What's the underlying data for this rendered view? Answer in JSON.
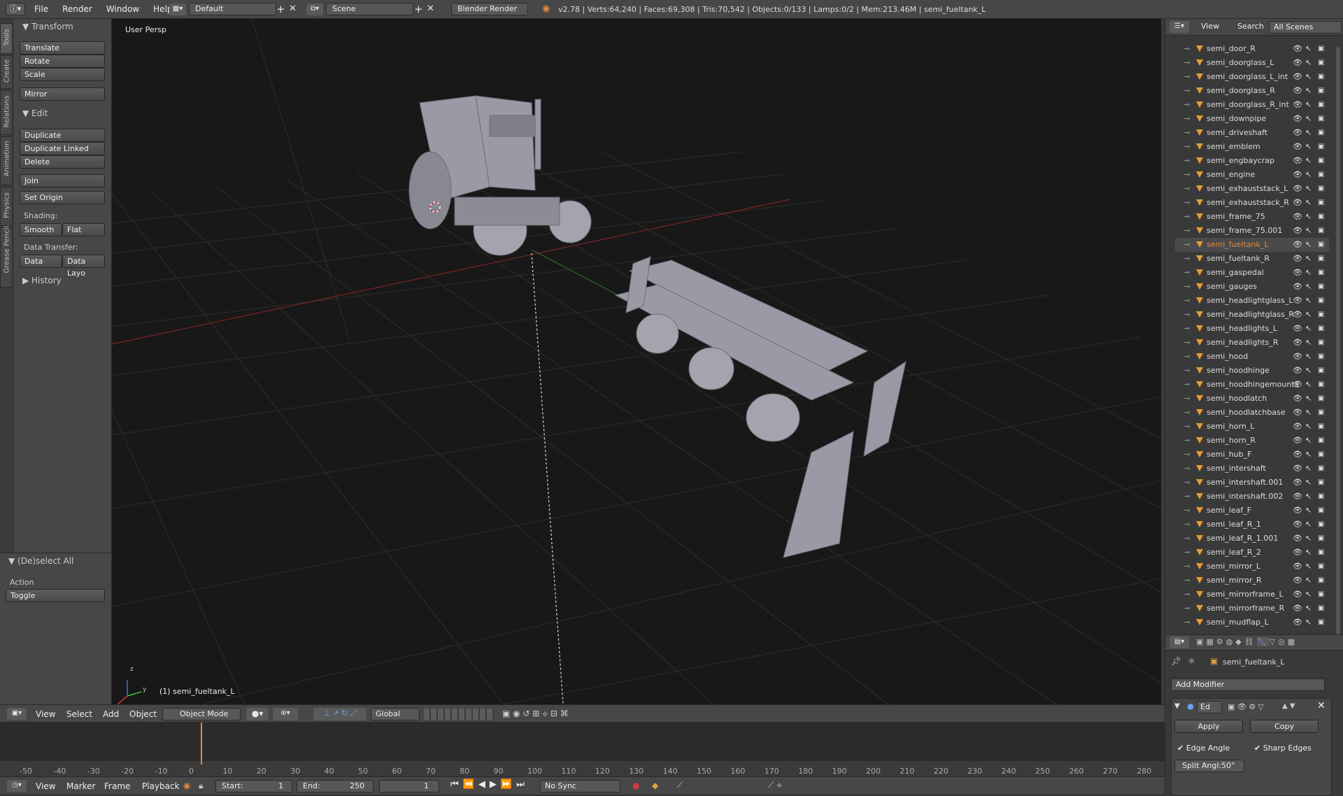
{
  "top_bar": {
    "menus": [
      "File",
      "Render",
      "Window",
      "Help"
    ],
    "layout": "Default",
    "scene": "Scene",
    "engine": "Blender Render",
    "stats": "v2.78 | Verts:64,240 | Faces:69,308 | Tris:70,542 | Objects:0/133 | Lamps:0/2 | Mem:213.46M | semi_fueltank_L"
  },
  "tool_tabs": [
    "Tools",
    "Create",
    "Relations",
    "Animation",
    "Physics",
    "Grease Pencil"
  ],
  "tool_shelf": {
    "transform_header": "Transform",
    "translate": "Translate",
    "rotate": "Rotate",
    "scale": "Scale",
    "mirror": "Mirror",
    "edit_header": "Edit",
    "duplicate": "Duplicate",
    "duplicate_linked": "Duplicate Linked",
    "delete": "Delete",
    "join": "Join",
    "set_origin": "Set Origin",
    "shading_label": "Shading:",
    "smooth": "Smooth",
    "flat": "Flat",
    "data_transfer_label": "Data Transfer:",
    "data": "Data",
    "data_layout": "Data Layo",
    "history_header": "History"
  },
  "operator_panel": {
    "header": "(De)select All",
    "action_label": "Action",
    "action_value": "Toggle"
  },
  "viewport": {
    "view_label": "User Persp",
    "object_label": "(1) semi_fueltank_L",
    "axis_z": "z",
    "axis_y": "y"
  },
  "view3d_header": {
    "menus": [
      "View",
      "Select",
      "Add",
      "Object"
    ],
    "mode": "Object Mode",
    "orientation": "Global"
  },
  "timeline": {
    "ticks": [
      "-50",
      "-40",
      "-30",
      "-20",
      "-10",
      "0",
      "10",
      "20",
      "30",
      "40",
      "50",
      "60",
      "70",
      "80",
      "90",
      "100",
      "110",
      "120",
      "130",
      "140",
      "150",
      "160",
      "170",
      "180",
      "190",
      "200",
      "210",
      "220",
      "230",
      "240",
      "250",
      "260",
      "270",
      "280"
    ],
    "current_frame_marker": 0,
    "menus": [
      "View",
      "Marker",
      "Frame",
      "Playback"
    ],
    "start_label": "Start:",
    "start_value": "1",
    "end_label": "End:",
    "end_value": "250",
    "current_frame": "1",
    "sync": "No Sync"
  },
  "outliner": {
    "header_menus": [
      "View",
      "Search"
    ],
    "scope": "All Scenes",
    "selected_color": "#e5883a",
    "items": [
      {
        "name": "semi_door_R"
      },
      {
        "name": "semi_doorglass_L"
      },
      {
        "name": "semi_doorglass_L_int"
      },
      {
        "name": "semi_doorglass_R"
      },
      {
        "name": "semi_doorglass_R_int"
      },
      {
        "name": "semi_downpipe"
      },
      {
        "name": "semi_driveshaft"
      },
      {
        "name": "semi_emblem"
      },
      {
        "name": "semi_engbaycrap"
      },
      {
        "name": "semi_engine"
      },
      {
        "name": "semi_exhauststack_L"
      },
      {
        "name": "semi_exhauststack_R"
      },
      {
        "name": "semi_frame_75"
      },
      {
        "name": "semi_frame_75.001"
      },
      {
        "name": "semi_fueltank_L",
        "selected": true
      },
      {
        "name": "semi_fueltank_R"
      },
      {
        "name": "semi_gaspedal"
      },
      {
        "name": "semi_gauges"
      },
      {
        "name": "semi_headlightglass_L"
      },
      {
        "name": "semi_headlightglass_R"
      },
      {
        "name": "semi_headlights_L"
      },
      {
        "name": "semi_headlights_R"
      },
      {
        "name": "semi_hood"
      },
      {
        "name": "semi_hoodhinge"
      },
      {
        "name": "semi_hoodhingemounts"
      },
      {
        "name": "semi_hoodlatch"
      },
      {
        "name": "semi_hoodlatchbase"
      },
      {
        "name": "semi_horn_L"
      },
      {
        "name": "semi_horn_R"
      },
      {
        "name": "semi_hub_F"
      },
      {
        "name": "semi_intershaft"
      },
      {
        "name": "semi_intershaft.001"
      },
      {
        "name": "semi_intershaft.002"
      },
      {
        "name": "semi_leaf_F"
      },
      {
        "name": "semi_leaf_R_1"
      },
      {
        "name": "semi_leaf_R_1.001"
      },
      {
        "name": "semi_leaf_R_2"
      },
      {
        "name": "semi_mirror_L"
      },
      {
        "name": "semi_mirror_R"
      },
      {
        "name": "semi_mirrorframe_L"
      },
      {
        "name": "semi_mirrorframe_R"
      },
      {
        "name": "semi_mudflap_L"
      }
    ]
  },
  "properties": {
    "object_name": "semi_fueltank_L",
    "add_modifier": "Add Modifier",
    "modifier_name": "Ed",
    "apply": "Apply",
    "copy": "Copy",
    "edge_angle": "Edge Angle",
    "sharp_edges": "Sharp Edges",
    "split_angle": "Split Angl:50°"
  }
}
